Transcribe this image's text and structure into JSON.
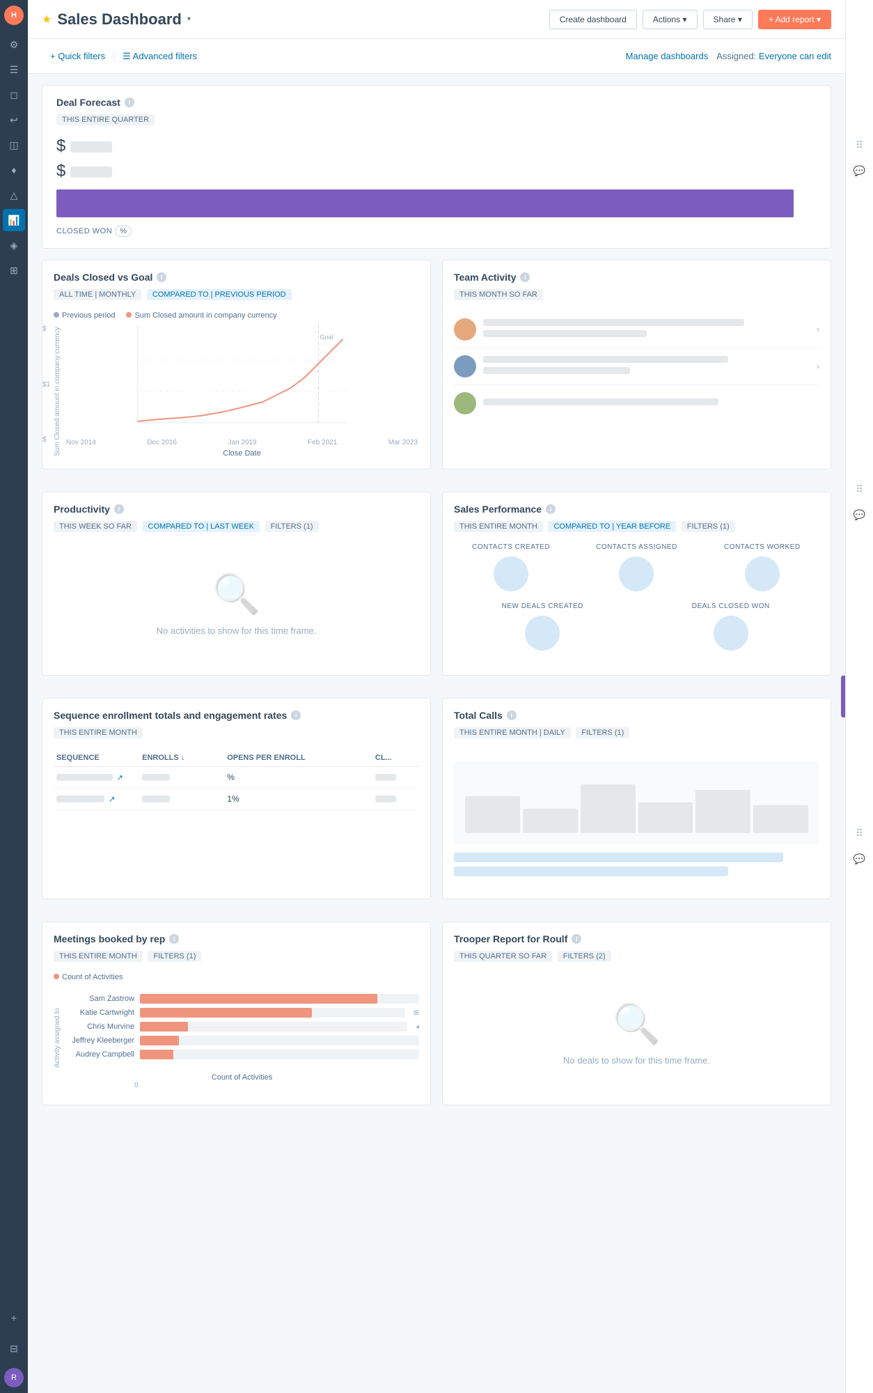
{
  "header": {
    "title": "Sales Dashboard",
    "star": "★",
    "dropdown": "▾",
    "buttons": {
      "create": "Create dashboard",
      "actions": "Actions ▾",
      "share": "Share ▾",
      "add_report": "+ Add report ▾"
    }
  },
  "filters": {
    "quick": "+ Quick filters",
    "advanced": "☰ Advanced filters",
    "manage": "Manage dashboards",
    "assigned_label": "Assigned:",
    "assigned_value": "Everyone can edit"
  },
  "deal_forecast": {
    "title": "Deal Forecast",
    "badge": "THIS ENTIRE QUARTER",
    "amount1": "$",
    "amount2": "$",
    "closed_won_label": "CLOSED WON",
    "closed_won_pct": "%"
  },
  "deals_closed": {
    "title": "Deals Closed vs Goal",
    "tags": [
      "ALL TIME | MONTHLY",
      "COMPARED TO | PREVIOUS PERIOD"
    ],
    "legend": [
      "Previous period",
      "Sum Closed amount in company currency"
    ],
    "x_labels": [
      "Nov 2014",
      "Dec 2016",
      "Jan 2019",
      "Feb 2021",
      "Mar 2023"
    ],
    "y_label": "Close Date",
    "axis_label": "Sum Closed amount in company currency",
    "y_ticks": [
      "$",
      "$1",
      "$"
    ]
  },
  "team_activity": {
    "title": "Team Activity",
    "badge": "THIS MONTH SO FAR",
    "items": [
      {
        "id": 1
      },
      {
        "id": 2
      },
      {
        "id": 3
      }
    ]
  },
  "productivity": {
    "title": "Productivity",
    "tags": [
      "THIS WEEK SO FAR",
      "COMPARED TO | LAST WEEK",
      "FILTERS (1)"
    ],
    "no_data": "No activities to show for this time frame."
  },
  "sales_performance": {
    "title": "Sales Performance",
    "tags": [
      "THIS ENTIRE MONTH",
      "COMPARED TO | YEAR BEFORE",
      "FILTERS (1)"
    ],
    "metrics": [
      "CONTACTS CREATED",
      "CONTACTS ASSIGNED",
      "CONTACTS WORKED",
      "NEW DEALS CREATED",
      "DEALS CLOSED WON"
    ]
  },
  "sequence_enrollment": {
    "title": "Sequence enrollment totals and engagement rates",
    "badge": "THIS ENTIRE MONTH",
    "columns": [
      "SEQUENCE",
      "ENROLLS ↓",
      "OPENS PER ENROLL",
      "CL... ENI..."
    ],
    "rows": [
      {
        "pct": "%"
      },
      {
        "pct": "1%"
      }
    ]
  },
  "total_calls": {
    "title": "Total Calls",
    "tags": [
      "THIS ENTIRE MONTH | DAILY",
      "FILTERS (1)"
    ]
  },
  "meetings_booked": {
    "title": "Meetings booked by rep",
    "tags": [
      "THIS ENTIRE MONTH",
      "FILTERS (1)"
    ],
    "legend": "Count of Activities",
    "y_axis": "Activity assigned to",
    "x_axis": "Count of Activities",
    "bars": [
      {
        "label": "Sam Zastrow",
        "width": 85
      },
      {
        "label": "Katie Cartwright",
        "width": 65
      },
      {
        "label": "Chris Murvine",
        "width": 18
      },
      {
        "label": "Jeffrey Kleeberger",
        "width": 14
      },
      {
        "label": "Audrey Campbell",
        "width": 12
      }
    ]
  },
  "trooper_report": {
    "title": "Trooper Report for Roulf",
    "tags": [
      "THIS QUARTER SO FAR",
      "FILTERS (2)"
    ],
    "no_data": "No deals to show for this time frame."
  },
  "sidebar": {
    "icons": [
      "⚙",
      "☰",
      "◻",
      "↩",
      "◫",
      "♦",
      "△",
      "📊",
      "◈",
      "⊞",
      "+",
      "⊟"
    ]
  }
}
